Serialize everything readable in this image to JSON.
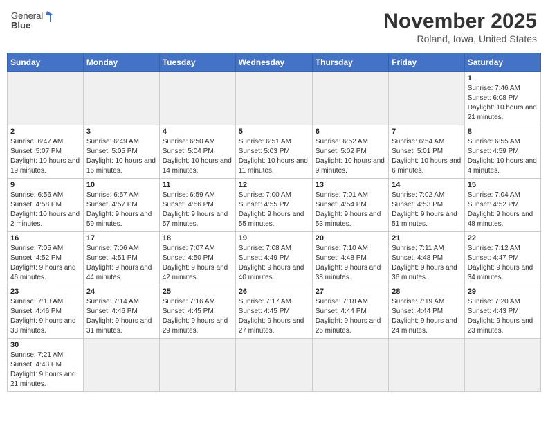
{
  "header": {
    "logo_text_normal": "General",
    "logo_text_bold": "Blue",
    "month_year": "November 2025",
    "location": "Roland, Iowa, United States"
  },
  "days_of_week": [
    "Sunday",
    "Monday",
    "Tuesday",
    "Wednesday",
    "Thursday",
    "Friday",
    "Saturday"
  ],
  "weeks": [
    [
      {
        "day": "",
        "info": ""
      },
      {
        "day": "",
        "info": ""
      },
      {
        "day": "",
        "info": ""
      },
      {
        "day": "",
        "info": ""
      },
      {
        "day": "",
        "info": ""
      },
      {
        "day": "",
        "info": ""
      },
      {
        "day": "1",
        "info": "Sunrise: 7:46 AM\nSunset: 6:08 PM\nDaylight: 10 hours and 21 minutes."
      }
    ],
    [
      {
        "day": "2",
        "info": "Sunrise: 6:47 AM\nSunset: 5:07 PM\nDaylight: 10 hours and 19 minutes."
      },
      {
        "day": "3",
        "info": "Sunrise: 6:49 AM\nSunset: 5:05 PM\nDaylight: 10 hours and 16 minutes."
      },
      {
        "day": "4",
        "info": "Sunrise: 6:50 AM\nSunset: 5:04 PM\nDaylight: 10 hours and 14 minutes."
      },
      {
        "day": "5",
        "info": "Sunrise: 6:51 AM\nSunset: 5:03 PM\nDaylight: 10 hours and 11 minutes."
      },
      {
        "day": "6",
        "info": "Sunrise: 6:52 AM\nSunset: 5:02 PM\nDaylight: 10 hours and 9 minutes."
      },
      {
        "day": "7",
        "info": "Sunrise: 6:54 AM\nSunset: 5:01 PM\nDaylight: 10 hours and 6 minutes."
      },
      {
        "day": "8",
        "info": "Sunrise: 6:55 AM\nSunset: 4:59 PM\nDaylight: 10 hours and 4 minutes."
      }
    ],
    [
      {
        "day": "9",
        "info": "Sunrise: 6:56 AM\nSunset: 4:58 PM\nDaylight: 10 hours and 2 minutes."
      },
      {
        "day": "10",
        "info": "Sunrise: 6:57 AM\nSunset: 4:57 PM\nDaylight: 9 hours and 59 minutes."
      },
      {
        "day": "11",
        "info": "Sunrise: 6:59 AM\nSunset: 4:56 PM\nDaylight: 9 hours and 57 minutes."
      },
      {
        "day": "12",
        "info": "Sunrise: 7:00 AM\nSunset: 4:55 PM\nDaylight: 9 hours and 55 minutes."
      },
      {
        "day": "13",
        "info": "Sunrise: 7:01 AM\nSunset: 4:54 PM\nDaylight: 9 hours and 53 minutes."
      },
      {
        "day": "14",
        "info": "Sunrise: 7:02 AM\nSunset: 4:53 PM\nDaylight: 9 hours and 51 minutes."
      },
      {
        "day": "15",
        "info": "Sunrise: 7:04 AM\nSunset: 4:52 PM\nDaylight: 9 hours and 48 minutes."
      }
    ],
    [
      {
        "day": "16",
        "info": "Sunrise: 7:05 AM\nSunset: 4:52 PM\nDaylight: 9 hours and 46 minutes."
      },
      {
        "day": "17",
        "info": "Sunrise: 7:06 AM\nSunset: 4:51 PM\nDaylight: 9 hours and 44 minutes."
      },
      {
        "day": "18",
        "info": "Sunrise: 7:07 AM\nSunset: 4:50 PM\nDaylight: 9 hours and 42 minutes."
      },
      {
        "day": "19",
        "info": "Sunrise: 7:08 AM\nSunset: 4:49 PM\nDaylight: 9 hours and 40 minutes."
      },
      {
        "day": "20",
        "info": "Sunrise: 7:10 AM\nSunset: 4:48 PM\nDaylight: 9 hours and 38 minutes."
      },
      {
        "day": "21",
        "info": "Sunrise: 7:11 AM\nSunset: 4:48 PM\nDaylight: 9 hours and 36 minutes."
      },
      {
        "day": "22",
        "info": "Sunrise: 7:12 AM\nSunset: 4:47 PM\nDaylight: 9 hours and 34 minutes."
      }
    ],
    [
      {
        "day": "23",
        "info": "Sunrise: 7:13 AM\nSunset: 4:46 PM\nDaylight: 9 hours and 33 minutes."
      },
      {
        "day": "24",
        "info": "Sunrise: 7:14 AM\nSunset: 4:46 PM\nDaylight: 9 hours and 31 minutes."
      },
      {
        "day": "25",
        "info": "Sunrise: 7:16 AM\nSunset: 4:45 PM\nDaylight: 9 hours and 29 minutes."
      },
      {
        "day": "26",
        "info": "Sunrise: 7:17 AM\nSunset: 4:45 PM\nDaylight: 9 hours and 27 minutes."
      },
      {
        "day": "27",
        "info": "Sunrise: 7:18 AM\nSunset: 4:44 PM\nDaylight: 9 hours and 26 minutes."
      },
      {
        "day": "28",
        "info": "Sunrise: 7:19 AM\nSunset: 4:44 PM\nDaylight: 9 hours and 24 minutes."
      },
      {
        "day": "29",
        "info": "Sunrise: 7:20 AM\nSunset: 4:43 PM\nDaylight: 9 hours and 23 minutes."
      }
    ],
    [
      {
        "day": "30",
        "info": "Sunrise: 7:21 AM\nSunset: 4:43 PM\nDaylight: 9 hours and 21 minutes."
      },
      {
        "day": "",
        "info": ""
      },
      {
        "day": "",
        "info": ""
      },
      {
        "day": "",
        "info": ""
      },
      {
        "day": "",
        "info": ""
      },
      {
        "day": "",
        "info": ""
      },
      {
        "day": "",
        "info": ""
      }
    ]
  ]
}
